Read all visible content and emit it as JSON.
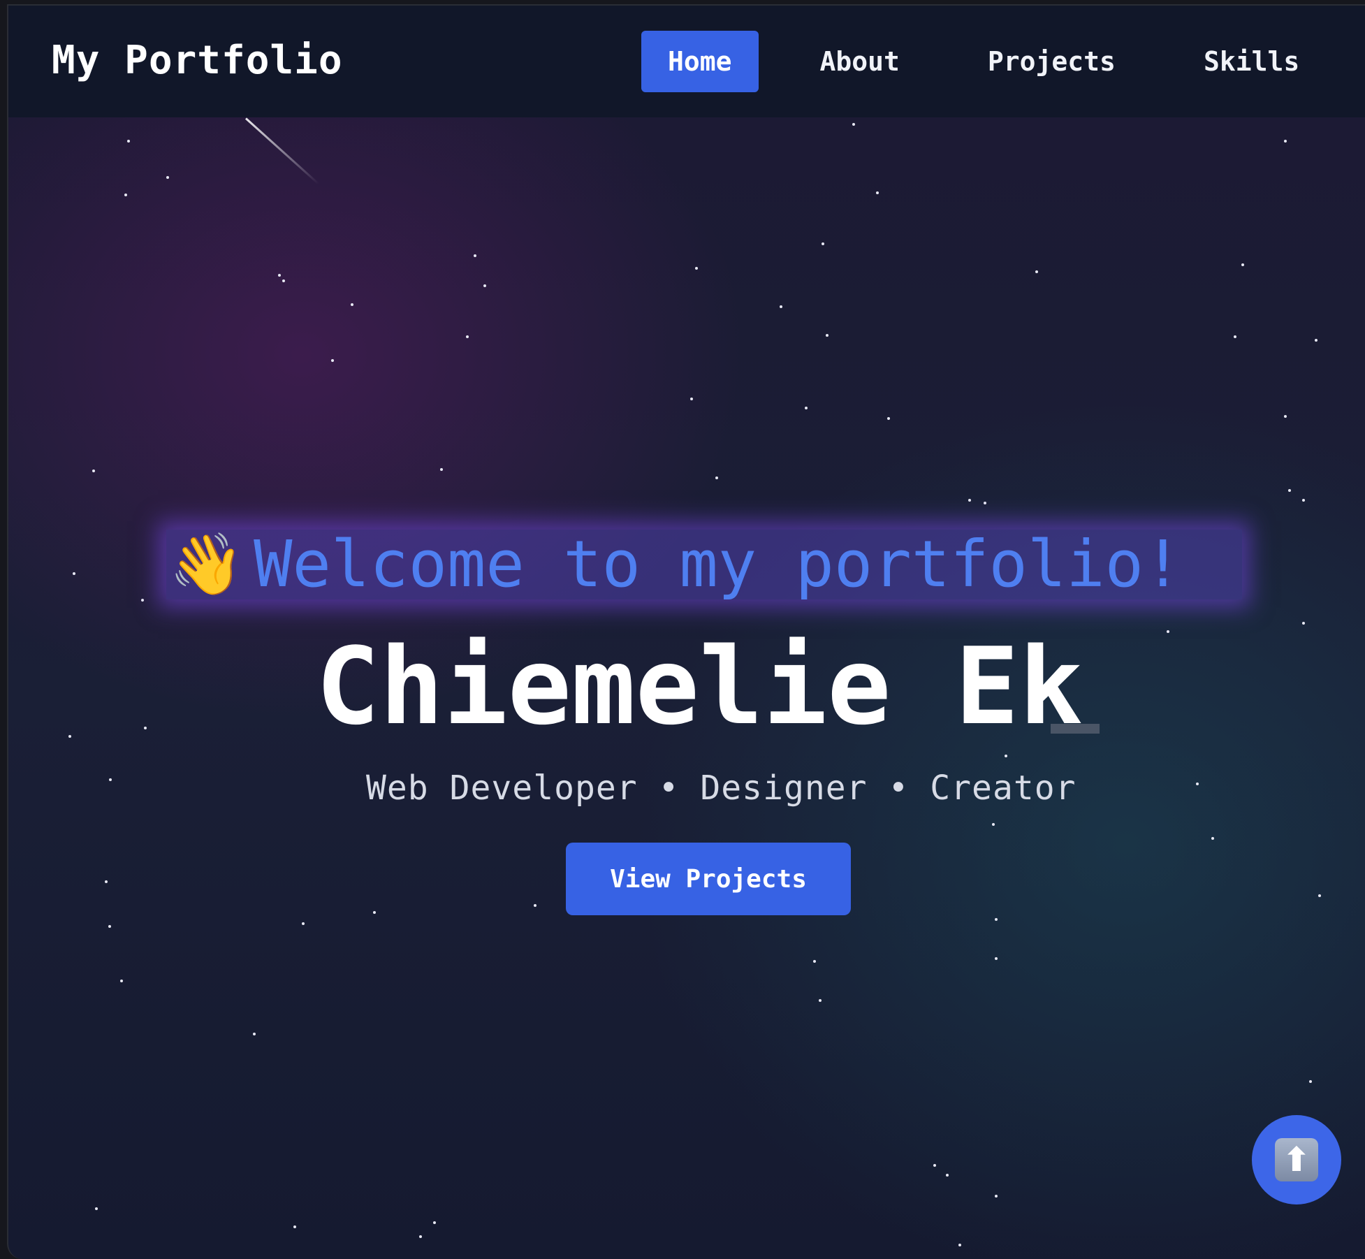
{
  "navbar": {
    "brand": "My Portfolio",
    "links": [
      {
        "label": "Home",
        "active": true
      },
      {
        "label": "About",
        "active": false
      },
      {
        "label": "Projects",
        "active": false
      },
      {
        "label": "Skills",
        "active": false
      }
    ]
  },
  "hero": {
    "welcome_emoji": "👋",
    "welcome_text": "Welcome to my portfolio!",
    "name": "Chiemelie Ek",
    "subtitle": "Web Developer • Designer • Creator",
    "cta_label": "View Projects"
  },
  "scroll_top": {
    "icon": "up-arrow-icon",
    "glyph": "⬆"
  },
  "colors": {
    "accent": "#3762e4",
    "welcome_text": "#4f7ff0",
    "nav_background": "#111729"
  }
}
